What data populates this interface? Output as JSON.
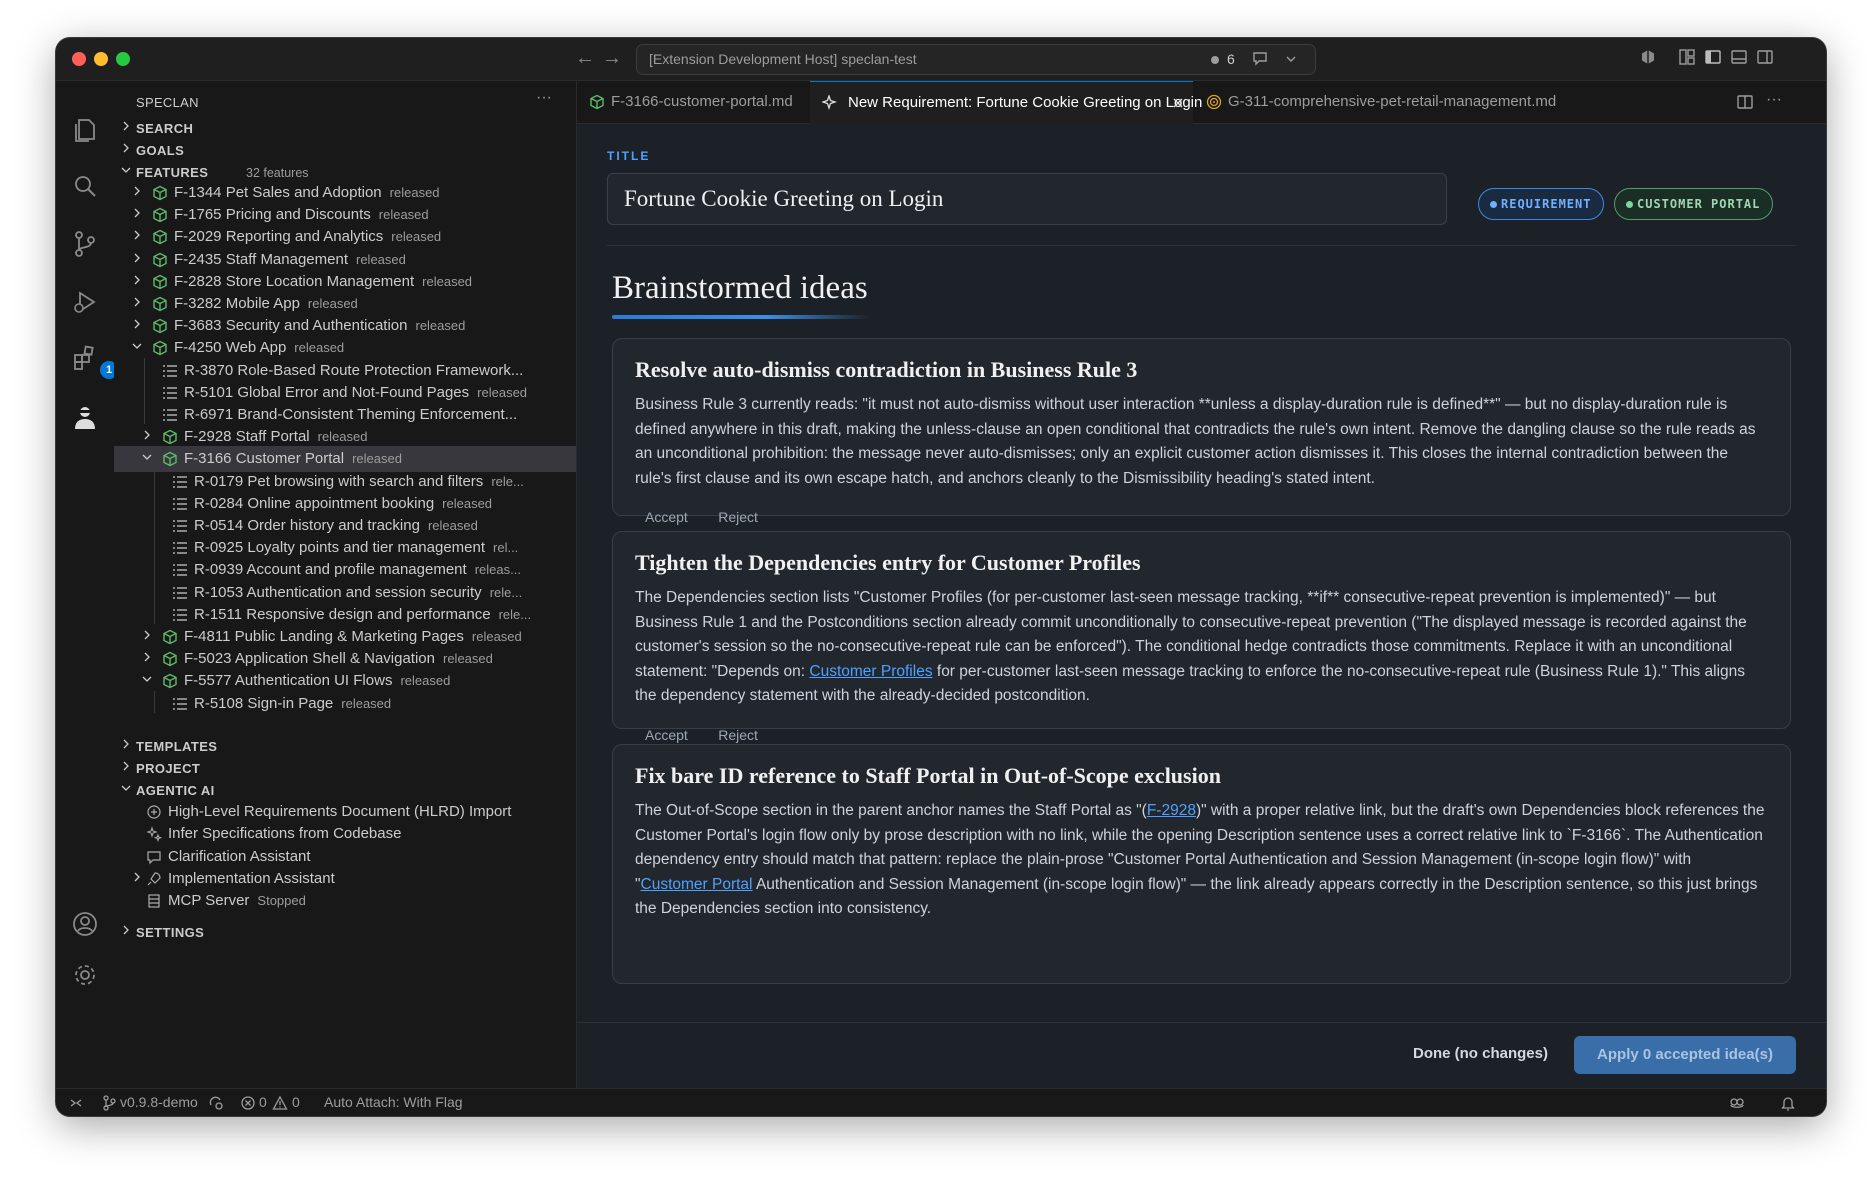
{
  "window": {
    "command_center": {
      "title": "[Extension Development Host] speclan-test",
      "count": "6"
    }
  },
  "sidebar": {
    "title": "SPECLAN",
    "sections": {
      "search": "SEARCH",
      "goals": "GOALS",
      "features": "FEATURES",
      "features_count": "32 features",
      "templates": "TEMPLATES",
      "project": "PROJECT",
      "agentic_ai": "AGENTIC AI",
      "settings": "SETTINGS"
    },
    "tree": [
      {
        "label": "F-1344 Pet Sales and Adoption",
        "status": "released"
      },
      {
        "label": "F-1765 Pricing and Discounts",
        "status": "released"
      },
      {
        "label": "F-2029 Reporting and Analytics",
        "status": "released"
      },
      {
        "label": "F-2435 Staff Management",
        "status": "released"
      },
      {
        "label": "F-2828 Store Location Management",
        "status": "released"
      },
      {
        "label": "F-3282 Mobile App",
        "status": "released"
      },
      {
        "label": "F-3683 Security and Authentication",
        "status": "released"
      },
      {
        "label": "F-4250 Web App",
        "status": "released"
      },
      {
        "label": "R-3870 Role-Based Route Protection Framework...",
        "status": ""
      },
      {
        "label": "R-5101 Global Error and Not-Found Pages",
        "status": "released"
      },
      {
        "label": "R-6971 Brand-Consistent Theming Enforcement...",
        "status": ""
      },
      {
        "label": "F-2928 Staff Portal",
        "status": "released"
      },
      {
        "label": "F-3166 Customer Portal",
        "status": "released"
      },
      {
        "label": "R-0179 Pet browsing with search and filters",
        "status": "rele..."
      },
      {
        "label": "R-0284 Online appointment booking",
        "status": "released"
      },
      {
        "label": "R-0514 Order history and tracking",
        "status": "released"
      },
      {
        "label": "R-0925 Loyalty points and tier management",
        "status": "rel..."
      },
      {
        "label": "R-0939 Account and profile management",
        "status": "releas..."
      },
      {
        "label": "R-1053 Authentication and session security",
        "status": "rele..."
      },
      {
        "label": "R-1511 Responsive design and performance",
        "status": "rele..."
      },
      {
        "label": "F-4811 Public Landing & Marketing Pages",
        "status": "released"
      },
      {
        "label": "F-5023 Application Shell & Navigation",
        "status": "released"
      },
      {
        "label": "F-5577 Authentication UI Flows",
        "status": "released"
      },
      {
        "label": "R-5108 Sign-in Page",
        "status": "released"
      }
    ],
    "agentic_items": [
      {
        "label": "High-Level Requirements Document (HLRD) Import",
        "status": ""
      },
      {
        "label": "Infer Specifications from Codebase",
        "status": ""
      },
      {
        "label": "Clarification Assistant",
        "status": ""
      },
      {
        "label": "Implementation Assistant",
        "status": ""
      },
      {
        "label": "MCP Server",
        "status": "Stopped"
      }
    ]
  },
  "tabs": [
    {
      "label": "F-3166-customer-portal.md"
    },
    {
      "label": "New Requirement: Fortune Cookie Greeting on Login"
    },
    {
      "label": "G-311-comprehensive-pet-retail-management.md"
    }
  ],
  "editor": {
    "title_label": "TITLE",
    "title_value": "Fortune Cookie Greeting on Login",
    "pill_type": "REQUIREMENT",
    "pill_parent": "CUSTOMER PORTAL",
    "heading": "Brainstormed ideas",
    "accept_label": "Accept",
    "reject_label": "Reject",
    "ideas": [
      {
        "title": "Resolve auto-dismiss contradiction in Business Rule 3",
        "body": "Business Rule 3 currently reads: \"it must not auto-dismiss without user interaction **unless a display-duration rule is defined**\" — but no display-duration rule is defined anywhere in this draft, making the unless-clause an open conditional that contradicts the rule's own intent. Remove the dangling clause so the rule reads as an unconditional prohibition: the message never auto-dismisses; only an explicit customer action dismisses it. This closes the internal contradiction between the rule's first clause and its own escape hatch, and anchors cleanly to the Dismissibility heading's stated intent."
      },
      {
        "title": "Tighten the Dependencies entry for Customer Profiles",
        "body_a": "The Dependencies section lists \"Customer Profiles (for per-customer last-seen message tracking, **if** consecutive-repeat prevention is implemented)\" — but Business Rule 1 and the Postconditions section already commit unconditionally to consecutive-repeat prevention (\"The displayed message is recorded against the customer's session so the no-consecutive-repeat rule can be enforced\"). The conditional hedge contradicts those commitments. Replace it with an unconditional statement: \"Depends on: ",
        "link": "Customer Profiles",
        "body_b": " for per-customer last-seen message tracking to enforce the no-consecutive-repeat rule (Business Rule 1).\" This aligns the dependency statement with the already-decided postcondition."
      },
      {
        "title": "Fix bare ID reference to Staff Portal in Out-of-Scope exclusion",
        "body_a": "The Out-of-Scope section in the parent anchor names the Staff Portal as \"(",
        "link1": "F-2928",
        "body_b": ")\" with a proper relative link, but the draft's own Dependencies block references the Customer Portal's login flow only by prose description with no link, while the opening Description sentence uses a correct relative link to `F-3166`. The Authentication dependency entry should match that pattern: replace the plain-prose \"Customer Portal Authentication and Session Management (in-scope login flow)\" with \"",
        "link2": "Customer Portal",
        "body_c": " Authentication and Session Management (in-scope login flow)\" — the link already appears correctly in the Description sentence, so this just brings the Dependencies section into consistency."
      }
    ],
    "done_label": "Done (no changes)",
    "apply_label": "Apply 0 accepted idea(s)"
  },
  "statusbar": {
    "branch": "v0.9.8-demo",
    "errors": "0",
    "warnings": "0",
    "auto_attach": "Auto Attach: With Flag"
  }
}
